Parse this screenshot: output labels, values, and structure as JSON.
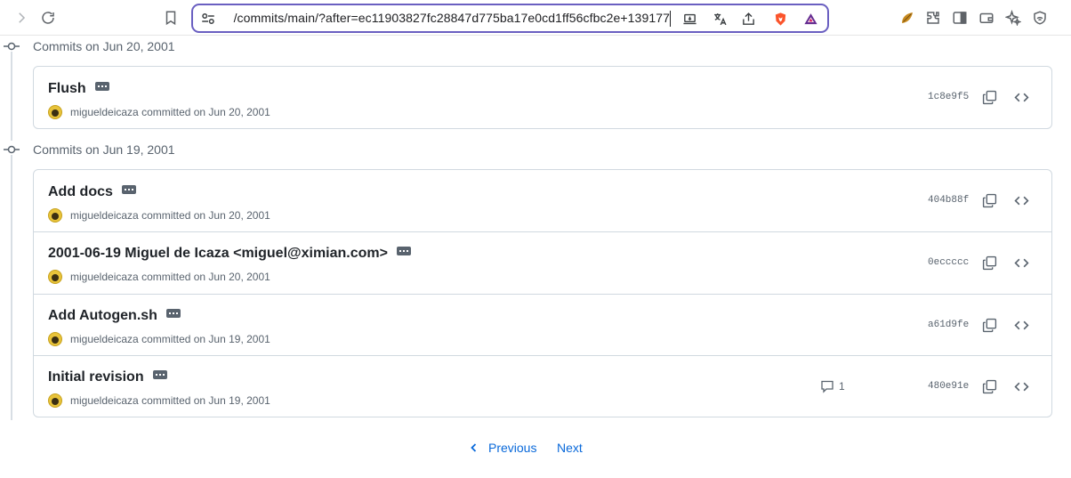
{
  "browser": {
    "url": "/commits/main/?after=ec11903827fc28847d775ba17e0cd1ff56cfbc2e+139177"
  },
  "groups": [
    {
      "title": "Commits on Jun 20, 2001",
      "commits": [
        {
          "title": "Flush",
          "author": "migueldeicaza",
          "committed": "committed on Jun 20, 2001",
          "sha": "1c8e9f5",
          "comments": ""
        }
      ]
    },
    {
      "title": "Commits on Jun 19, 2001",
      "commits": [
        {
          "title": "Add docs",
          "author": "migueldeicaza",
          "committed": "committed on Jun 20, 2001",
          "sha": "404b88f",
          "comments": ""
        },
        {
          "title": "2001-06-19 Miguel de Icaza <miguel@ximian.com>",
          "author": "migueldeicaza",
          "committed": "committed on Jun 20, 2001",
          "sha": "0eccccc",
          "comments": ""
        },
        {
          "title": "Add Autogen.sh",
          "author": "migueldeicaza",
          "committed": "committed on Jun 19, 2001",
          "sha": "a61d9fe",
          "comments": ""
        },
        {
          "title": "Initial revision",
          "author": "migueldeicaza",
          "committed": "committed on Jun 19, 2001",
          "sha": "480e91e",
          "comments": "1"
        }
      ]
    }
  ],
  "pagination": {
    "previous": "Previous",
    "next": "Next"
  },
  "colors": {
    "accent": "#0969da",
    "urlbar_border": "#6a5fc1",
    "muted": "#59636e",
    "border": "#d1d9e0"
  }
}
